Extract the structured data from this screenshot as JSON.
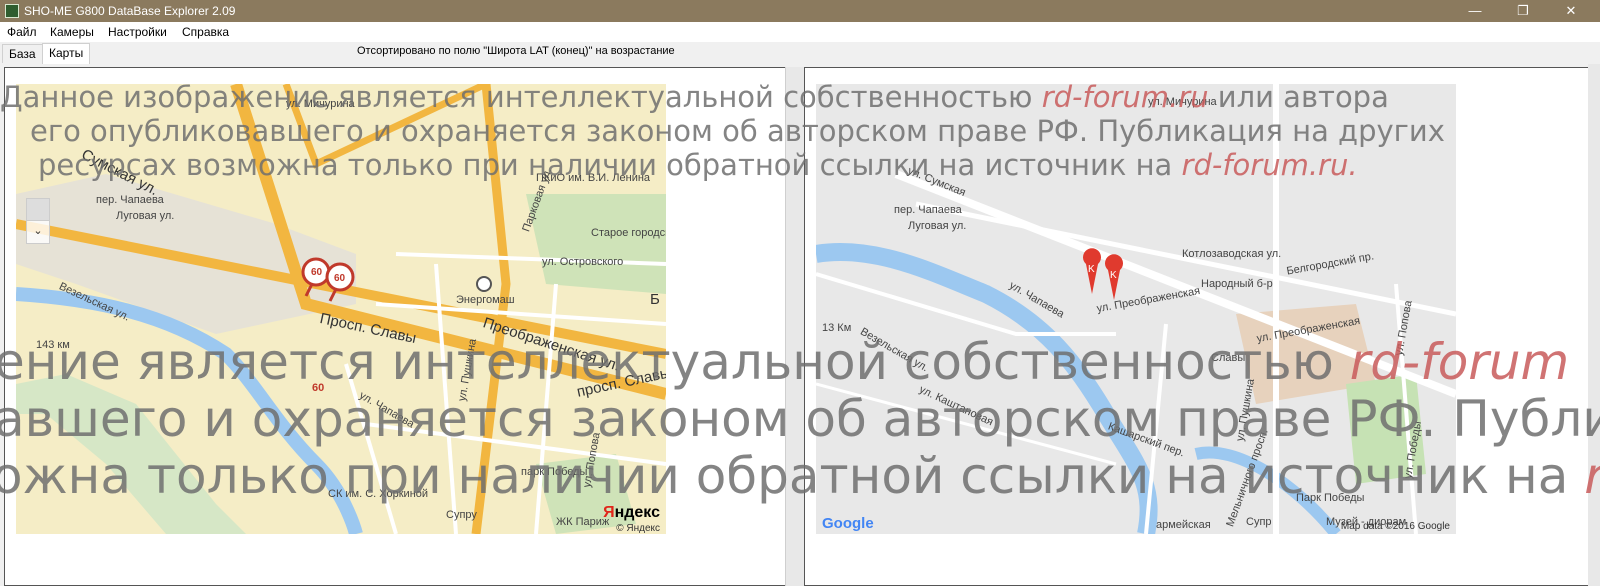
{
  "window": {
    "title": "SHO-ME G800 DataBase Explorer 2.09",
    "controls": [
      "—",
      "❐",
      "✕"
    ]
  },
  "menu": [
    "Файл",
    "Камеры",
    "Настройки",
    "Справка"
  ],
  "tabs": [
    {
      "label": "База",
      "active": false
    },
    {
      "label": "Карты",
      "active": true
    }
  ],
  "status": "Отсортировано по полю \"Широта LAT (конец)\" на возрастание",
  "yandex_map": {
    "labels": {
      "michurina": "ул. Мичурина",
      "sumskaya": "Сумская ул.",
      "chapaeva_per": "пер. Чапаева",
      "lugovaya": "Луговая ул.",
      "vezelskaya": "Везельская ул.",
      "km": "143 км",
      "park": "ПКиО им. В.И. Ленина",
      "parkovaya": "Парковая ул.",
      "cemetery": "Старое городское кладбище",
      "ostrovskogo": "ул. Островского",
      "energomash": "Энергомаш",
      "slavy": "Просп. Славы",
      "preobr": "Преображенская ул.",
      "slavy2": "просп. Славы",
      "pushkina": "ул. Пушкина",
      "chapaeva": "ул. Чапаева",
      "popova": "ул. Попова",
      "park_pobedy": "парк Победы",
      "sk": "СК им. С. Хоркиной",
      "zhk": "ЖК Париж",
      "supr": "Супру",
      "b": "Б"
    },
    "markers": [
      "60",
      "60"
    ],
    "logo_y": "Я",
    "logo_rest": "ндекс",
    "copyright": "© Яндекс"
  },
  "google_map": {
    "labels": {
      "michurina": "ул. Мичурина",
      "sumskaya": "ул. Сумская",
      "chapaeva_per": "пер. Чапаева",
      "lugovaya": "Луговая ул.",
      "kotlozavodskaya": "Котлозаводская ул.",
      "narodny": "Народный б-р",
      "belgorodsky": "Белгородский пр.",
      "preobr": "ул. Преображенская",
      "preobr2": "ул. Преображенская",
      "chapaeva": "ул. Чапаева",
      "km": "13 Км",
      "vezelskaya": "Везельская ул.",
      "kashtanovaya": "ул. Каштановая",
      "slavy": "Славы",
      "pushkina": "ул. Пушкина",
      "popova": "ул. Попова",
      "pobedy": "ул. Победы",
      "park_pobedy": "Парк Победы",
      "museum": "Музей - диорам",
      "kasharsky": "Кашарский пер.",
      "melnichny": "Мельничного просп.",
      "armeyskaya": "армейская",
      "supr": "Супр"
    },
    "markers": [
      "K",
      "K"
    ],
    "logo": "Google",
    "copyright": "Map data ©2016 Google"
  },
  "watermark": {
    "line1_a": "Данное изображение является интеллектуальной собственностью ",
    "line1_rd": "rd-forum.ru",
    "line1_b": " или автора",
    "line2": "его опубликовавшего и охраняется законом об авторском праве РФ. Публикация на других",
    "line3_a": "ресурсах возможна только при наличии обратной ссылки на источник на ",
    "line3_rd": "rd-forum.ru.",
    "big1_a": "ение является интеллектуальной собственностью ",
    "big1_rd": "rd-forum",
    "big2": "авшего и охраняется законом об авторском праве РФ. Публика",
    "big3_a": "ожна только при наличии обратной ссылки на источник на ",
    "big3_rd": "rd"
  },
  "colors": {
    "titlebar": "#8b7a5e",
    "yandex_bg": "#f5edc6",
    "yandex_road": "#f2b640",
    "google_bg": "#e8e8e8",
    "water": "#9cc8f0",
    "marker_red": "#e03a2e"
  }
}
